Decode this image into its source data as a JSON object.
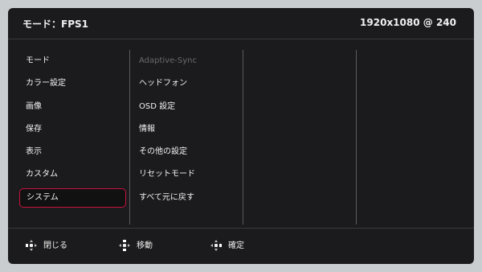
{
  "header": {
    "mode_text": "モード：FPS1",
    "resolution_text": "1920x1080 @ 240"
  },
  "menu": {
    "items": [
      {
        "label": "モード"
      },
      {
        "label": "カラー設定"
      },
      {
        "label": "画像"
      },
      {
        "label": "保存"
      },
      {
        "label": "表示"
      },
      {
        "label": "カスタム"
      },
      {
        "label": "システム"
      }
    ],
    "selected_index": 6
  },
  "submenu": {
    "items": [
      {
        "label": "Adaptive-Sync",
        "enabled": false
      },
      {
        "label": "ヘッドフォン",
        "enabled": true
      },
      {
        "label": "OSD 設定",
        "enabled": true
      },
      {
        "label": "情報",
        "enabled": true
      },
      {
        "label": "その他の設定",
        "enabled": true
      },
      {
        "label": "リセットモード",
        "enabled": true
      },
      {
        "label": "すべて元に戻す",
        "enabled": true
      }
    ]
  },
  "footer": {
    "hints": [
      {
        "icon": "dpad-left-icon",
        "label": "閉じる"
      },
      {
        "icon": "dpad-updown-icon",
        "label": "移動"
      },
      {
        "icon": "dpad-right-icon",
        "label": "確定"
      }
    ]
  },
  "colors": {
    "selection_border": "#c8123f",
    "panel_background": "#1b1b1d",
    "disabled_text": "#6a6a6e"
  }
}
